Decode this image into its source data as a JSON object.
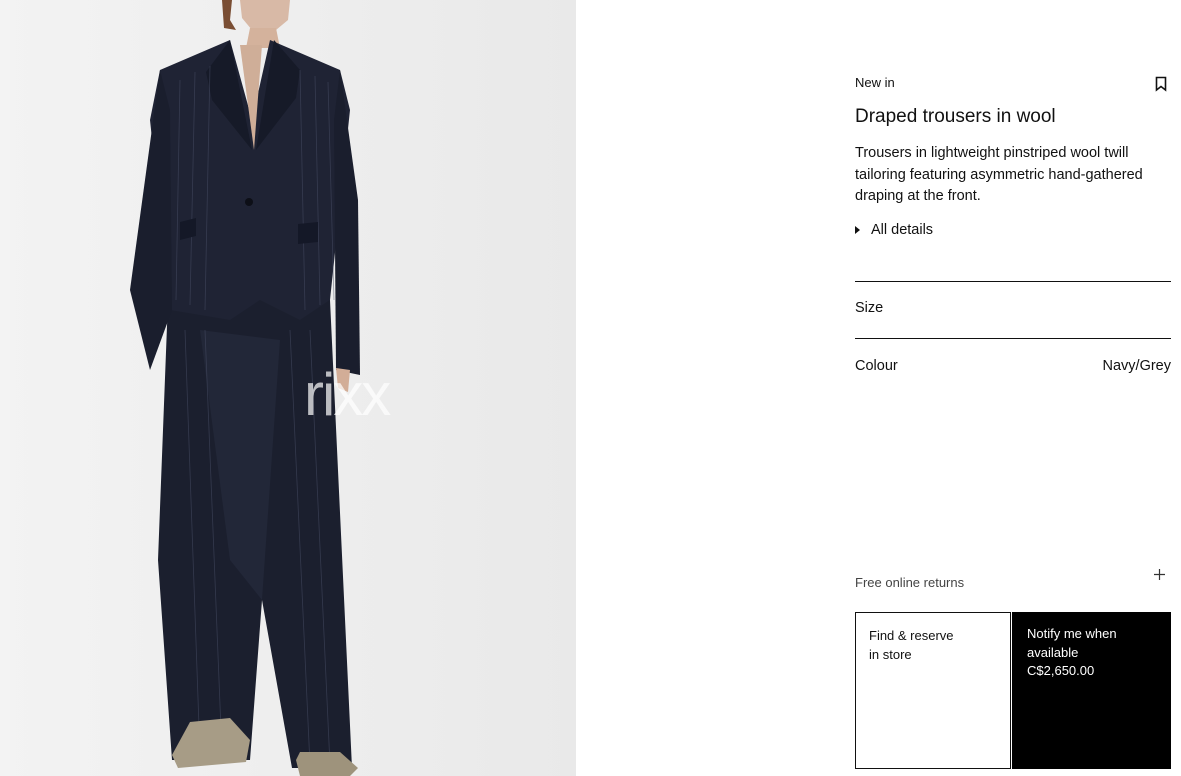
{
  "product": {
    "badge": "New in",
    "title": "Draped trousers in wool",
    "description": "Trousers in lightweight pinstriped wool twill tailoring featuring asymmetric hand-gathered draping at the front.",
    "details_label": "All details",
    "image_watermark": "rixx"
  },
  "options": {
    "size_label": "Size",
    "colour_label": "Colour",
    "colour_value": "Navy/Grey"
  },
  "returns": {
    "label": "Free online returns"
  },
  "actions": {
    "store_line1": "Find & reserve",
    "store_line2": "in store",
    "notify_line1": "Notify me when",
    "notify_line2": "available",
    "price": "C$2,650.00"
  },
  "icons": {
    "bookmark": "bookmark-icon",
    "expand": "plus-icon",
    "details": "triangle-right-icon"
  },
  "colors": {
    "suit": "#1b1f2e",
    "background": "#efefef",
    "button_dark": "#000000"
  }
}
